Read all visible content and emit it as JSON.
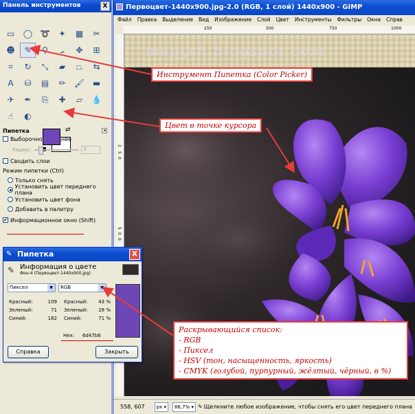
{
  "toolbox": {
    "title": "Панель инструментов",
    "close": "X",
    "tools": [
      {
        "name": "rect-select-icon",
        "glyph": "▭"
      },
      {
        "name": "ellipse-select-icon",
        "glyph": "◯"
      },
      {
        "name": "free-select-icon",
        "glyph": "➰"
      },
      {
        "name": "fuzzy-select-icon",
        "glyph": "✦"
      },
      {
        "name": "select-by-color-icon",
        "glyph": "▦"
      },
      {
        "name": "scissors-icon",
        "glyph": "✂"
      },
      {
        "name": "foreground-select-icon",
        "glyph": "☻"
      },
      {
        "name": "color-picker-icon",
        "glyph": "✎",
        "active": true
      },
      {
        "name": "zoom-icon",
        "glyph": "⚲"
      },
      {
        "name": "measure-icon",
        "glyph": "⦟"
      },
      {
        "name": "move-icon",
        "glyph": "✥"
      },
      {
        "name": "align-icon",
        "glyph": "⊞"
      },
      {
        "name": "crop-icon",
        "glyph": "⌗"
      },
      {
        "name": "rotate-icon",
        "glyph": "↻"
      },
      {
        "name": "scale-icon",
        "glyph": "⤡"
      },
      {
        "name": "shear-icon",
        "glyph": "▰"
      },
      {
        "name": "perspective-icon",
        "glyph": "⏢"
      },
      {
        "name": "flip-icon",
        "glyph": "⇆"
      },
      {
        "name": "text-icon",
        "glyph": "A"
      },
      {
        "name": "bucket-fill-icon",
        "glyph": "⛁"
      },
      {
        "name": "blend-icon",
        "glyph": "▤"
      },
      {
        "name": "pencil-icon",
        "glyph": "✏"
      },
      {
        "name": "paintbrush-icon",
        "glyph": "🖌"
      },
      {
        "name": "eraser-icon",
        "glyph": "▬"
      },
      {
        "name": "airbrush-icon",
        "glyph": "✈"
      },
      {
        "name": "ink-icon",
        "glyph": "✒"
      },
      {
        "name": "clone-icon",
        "glyph": "⎘"
      },
      {
        "name": "heal-icon",
        "glyph": "✚"
      },
      {
        "name": "perspective-clone-icon",
        "glyph": "▱"
      },
      {
        "name": "blur-icon",
        "glyph": "💧"
      },
      {
        "name": "smudge-icon",
        "glyph": "☝"
      },
      {
        "name": "dodge-burn-icon",
        "glyph": "◐"
      }
    ],
    "options": {
      "title": "Пипетка",
      "sample_average": "Выборочное среднее",
      "radius_label": "Радиус:",
      "radius_value": "3",
      "sample_merged": "Сводить слои",
      "mode_label": "Режим пипетки (Ctrl)",
      "modes": [
        "Только снять",
        "Установить цвет переднего плана",
        "Установить цвет фона",
        "Добавить в палитру"
      ],
      "info_window": "Информационное окно (Shift)"
    }
  },
  "dialog": {
    "title": "Пипетка",
    "close": "X",
    "heading": "Информация о цвете",
    "subheading": "Фон-4 (Первоцвет-1440x900.jpg)",
    "left_select": "Пиксел",
    "right_select": "RGB",
    "left_values": [
      {
        "label": "Красный:",
        "value": "109"
      },
      {
        "label": "Зеленый:",
        "value": "71"
      },
      {
        "label": "Синий:",
        "value": "182"
      }
    ],
    "right_values": [
      {
        "label": "Красный:",
        "value": "43 %"
      },
      {
        "label": "Зеленый:",
        "value": "28 %"
      },
      {
        "label": "Синий:",
        "value": "71 %"
      }
    ],
    "hex_label": "Hex:",
    "hex_value": "6d47b6",
    "help_button": "Справка",
    "close_button": "Закрыть"
  },
  "image_window": {
    "title": "Первоцвет-1440x900.jpg-2.0 (RGB, 1 слой) 1440x900 - GIMP",
    "menu": [
      "Файл",
      "Правка",
      "Выделение",
      "Вид",
      "Изображение",
      "Слой",
      "Цвет",
      "Инструменты",
      "Фильтры",
      "Окна",
      "Справ"
    ],
    "ruler_h": [
      "250",
      "500",
      "750",
      "1000"
    ],
    "ruler_v": [
      "2",
      "5",
      "0",
      "5",
      "0",
      "0",
      "5",
      "0"
    ],
    "watermark": "mapysh.blogspot.com",
    "status": {
      "coords": "558, 607",
      "unit": "px",
      "zoom": "66,7%",
      "message": "Щелкните любое изображение, чтобы снять его цвет переднего плана"
    }
  },
  "annotations": {
    "tool_label": "Инструмент Пипетка (Color Picker)",
    "cursor_color": "Цвет в точке курсора",
    "dropdown_title": "Раскрывающийся список:",
    "dropdown_items": [
      "- RGB",
      "- Пиксел",
      "- HSV (тон, насыщенность, яркость)",
      "- CMYK (голубой, пурпурный, жёлтый, чёрный, в %)"
    ]
  },
  "colors": {
    "picked": "#6d47b6",
    "annotation_red": "#e63c3c"
  }
}
